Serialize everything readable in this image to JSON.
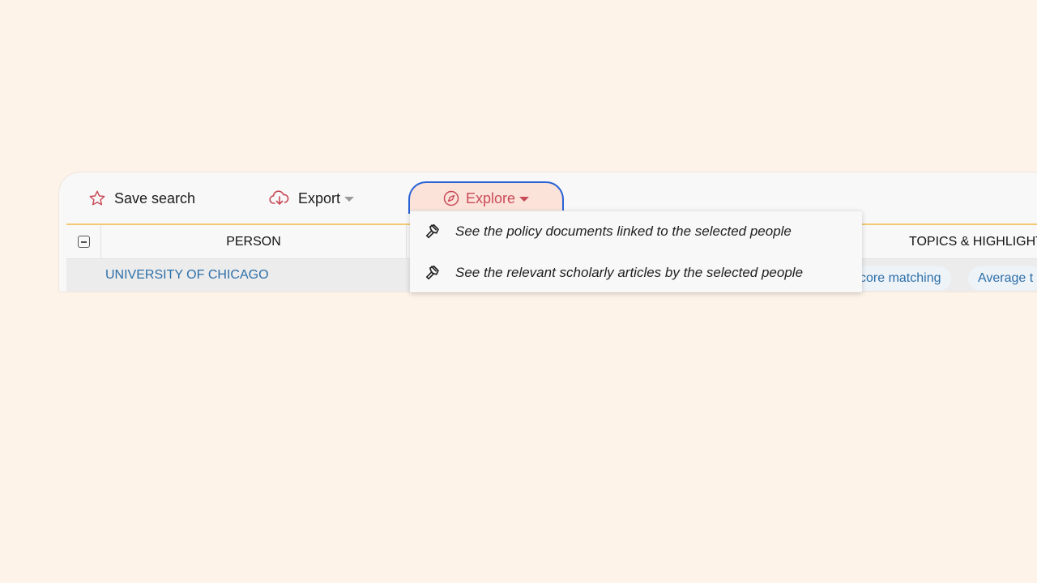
{
  "toolbar": {
    "save_label": "Save search",
    "export_label": "Export",
    "explore_label": "Explore"
  },
  "table": {
    "columns": [
      "PERSON",
      "TOPICS & HIGHLIGHT"
    ],
    "row": {
      "organization": "UNIVERSITY OF CHICAGO",
      "chips": [
        "core matching",
        "Average t"
      ]
    }
  },
  "explore_menu": {
    "items": [
      "See the policy documents linked to the selected people",
      "See the relevant scholarly articles by the selected people"
    ]
  },
  "icons": {
    "save": "star-icon",
    "export": "cloud-download-icon",
    "explore": "compass-icon",
    "menu_item": "gavel-icon"
  },
  "colors": {
    "background": "#fdf3e9",
    "accent_red": "#c94a57",
    "focus_blue": "#2a63d6",
    "divider_gold": "#f2c970",
    "link_blue": "#2d6fa8"
  }
}
